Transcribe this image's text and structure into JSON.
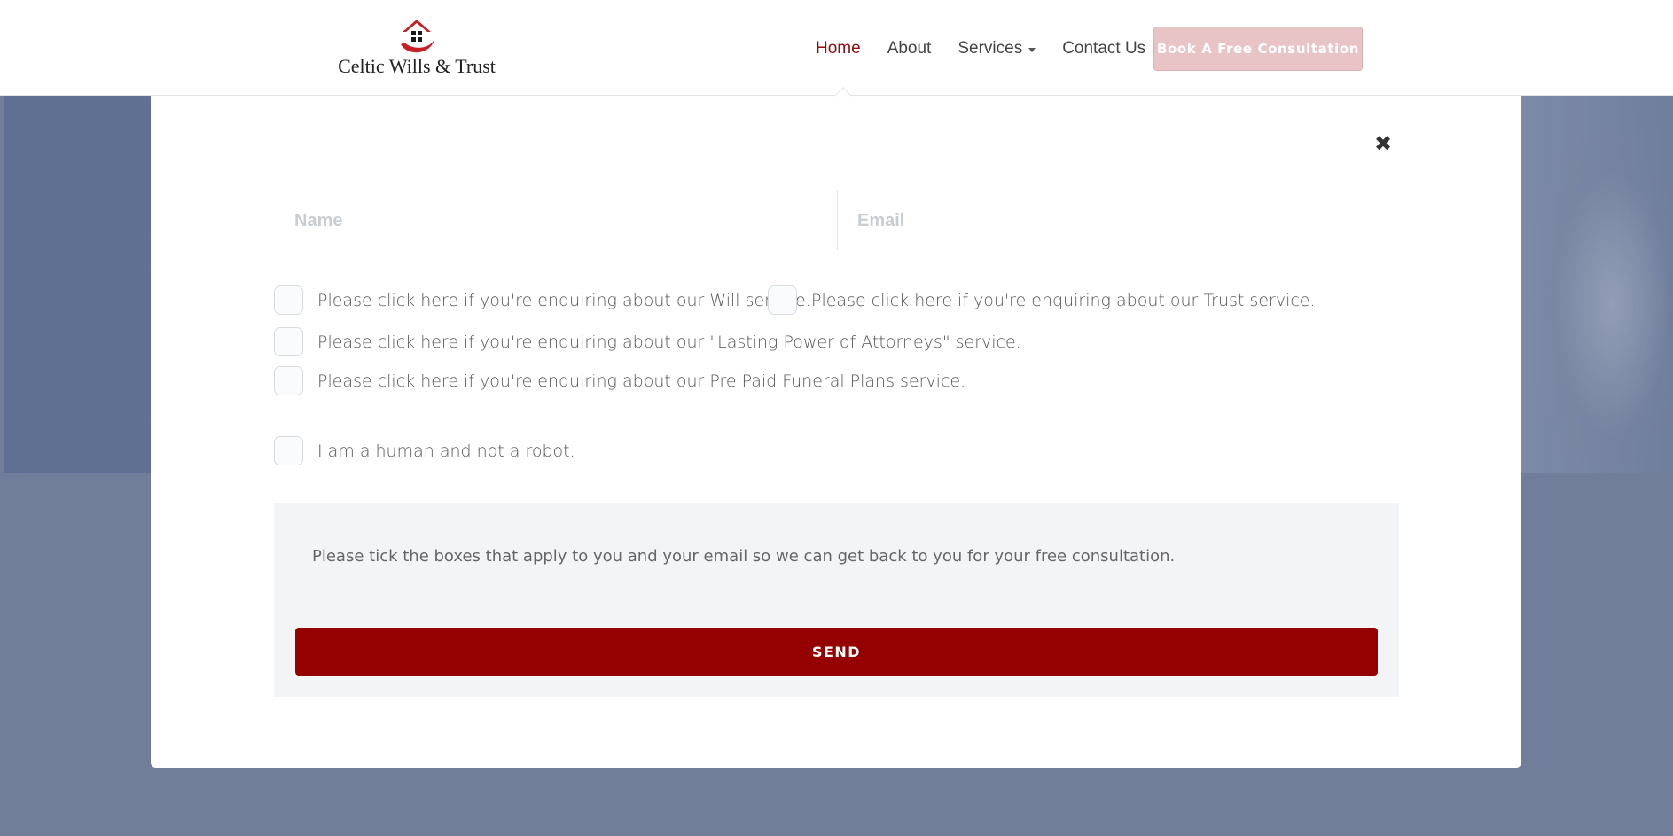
{
  "header": {
    "logo_text": "Celtic Wills & Trust",
    "nav": [
      {
        "label": "Home",
        "active": true
      },
      {
        "label": "About"
      },
      {
        "label": "Services",
        "has_dropdown": true
      },
      {
        "label": "Contact Us"
      }
    ],
    "cta_label": "Book A Free Consultation"
  },
  "modal": {
    "close_icon": "close-icon",
    "fields": {
      "name_placeholder": "Name",
      "email_placeholder": "Email"
    },
    "checkboxes": [
      {
        "label": "Please click here if you're enquiring about our Will service.",
        "checked": false
      },
      {
        "label": "Please click here if you're enquiring about our Trust service.",
        "checked": false
      },
      {
        "label": "Please click here if you're enquiring about our \"Lasting Power of Attorneys\" service.",
        "checked": false
      },
      {
        "label": "Please click here if you're enquiring about our Pre Paid Funeral Plans service.",
        "checked": false
      }
    ],
    "captcha_label": "I am a human and not a robot.",
    "info_text": "Please tick the boxes that apply to you and your email so we can get back to you for your free consultation.",
    "send_label": "SEND"
  },
  "colors": {
    "brand_red": "#950000",
    "nav_active": "#8e0d0d",
    "cta_bg": "#e9c4c6",
    "overlay": "#707e9a"
  }
}
